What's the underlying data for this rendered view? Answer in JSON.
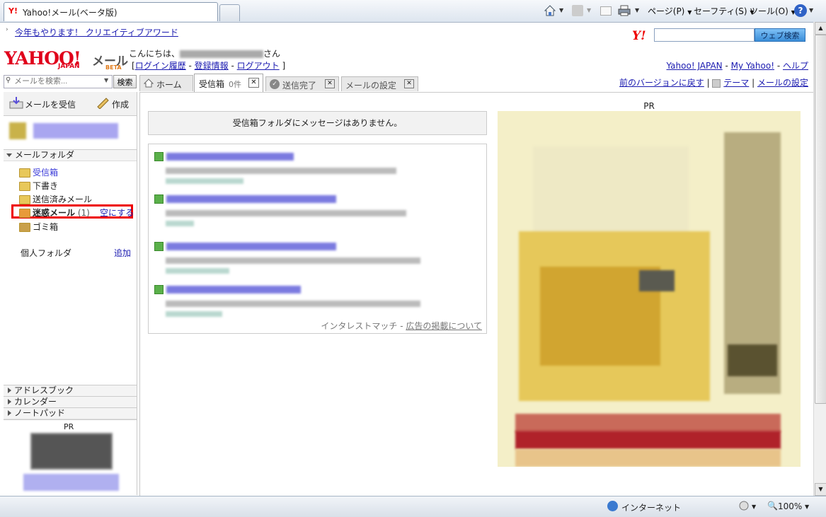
{
  "browser": {
    "tab_title": "Yahoo!メール(ベータ版)",
    "menu": {
      "page": "ページ(P)",
      "safety": "セーフティ(S)",
      "tools": "ツール(O)",
      "help": "?"
    }
  },
  "header": {
    "promo_link": "今年もやります！ クリエイティブアワード",
    "search_button": "ウェブ検索",
    "logo_text": "YAHOO!",
    "logo_sub": "JAPAN",
    "mail_label": "メール",
    "beta_label": "BETA",
    "greeting_prefix": "こんにちは、",
    "greeting_suffix": "さん",
    "login_history": "ログイン履歴",
    "account_info": "登録情報",
    "logout": "ログアウト",
    "yahoo_japan": "Yahoo! JAPAN",
    "my_yahoo": "My Yahoo!",
    "help": "ヘルプ",
    "prev_version": "前のバージョンに戻す",
    "theme": "テーマ",
    "mail_settings": "メールの設定"
  },
  "search": {
    "placeholder": "メールを検索...",
    "button": "検索"
  },
  "tabs": [
    {
      "label": "ホーム"
    },
    {
      "label": "受信箱",
      "count": "0件"
    },
    {
      "label": "送信完了"
    },
    {
      "label": "メールの設定"
    }
  ],
  "toolbar": {
    "receive": "メールを受信",
    "compose": "作成"
  },
  "folders": {
    "section_title": "メールフォルダ",
    "inbox": "受信箱",
    "drafts": "下書き",
    "sent": "送信済みメール",
    "spam": "迷惑メール",
    "spam_count": "(1)",
    "empty": "空にする",
    "trash": "ゴミ箱",
    "personal": "個人フォルダ",
    "add": "追加"
  },
  "sections": [
    "アドレスブック",
    "カレンダー",
    "ノートパッド"
  ],
  "pr_label": "PR",
  "main": {
    "empty_message": "受信箱フォルダにメッセージはありません。",
    "ads_footer": "インタレストマッチ",
    "ads_link": "広告の掲載について"
  },
  "status": {
    "zone": "インターネット",
    "zoom": "100%"
  }
}
